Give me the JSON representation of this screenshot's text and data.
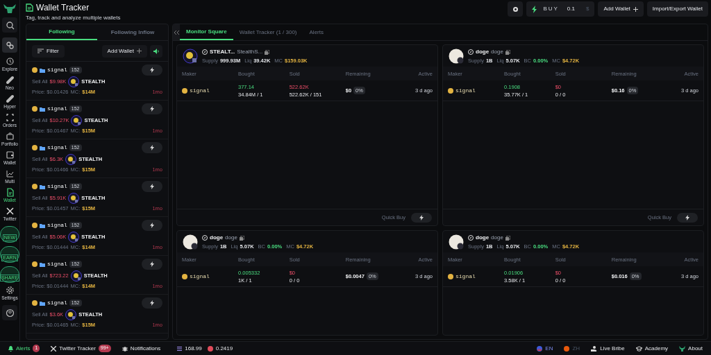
{
  "header": {
    "title": "Wallet Tracker",
    "subtitle": "Tag, track and analyze multiple wallets"
  },
  "toolbar": {
    "buy_label": "BUY",
    "buy_amount": "0.1",
    "currency": "$",
    "add_wallet": "Add Wallet",
    "import_export": "Import/Export Wallet"
  },
  "sidebar": {
    "items": [
      {
        "kind": "icon",
        "selected": false
      },
      {
        "kind": "icon",
        "selected": true
      },
      {
        "kind": "nav",
        "label": "Explore",
        "selected": false
      },
      {
        "kind": "nav",
        "label": "Neo",
        "selected": false
      },
      {
        "kind": "nav",
        "label": "Hyper",
        "selected": false
      },
      {
        "kind": "nav",
        "label": "Orders",
        "selected": false
      },
      {
        "kind": "nav",
        "label": "Portfolio",
        "selected": false
      },
      {
        "kind": "nav",
        "label": "Wallet",
        "selected": false
      },
      {
        "kind": "nav",
        "label": "Multi",
        "selected": false
      },
      {
        "kind": "nav",
        "label": "Wallet",
        "selected": true
      },
      {
        "kind": "nav",
        "label": "Twitter",
        "selected": false
      },
      {
        "kind": "badge",
        "label": "NEW"
      },
      {
        "kind": "badge",
        "label": "EARN"
      },
      {
        "kind": "badge",
        "label": "SHARE"
      },
      {
        "kind": "nav",
        "label": "Settings",
        "selected": false
      },
      {
        "kind": "icon",
        "selected": false
      }
    ]
  },
  "feed_tabs": [
    {
      "label": "Following",
      "selected": true
    },
    {
      "label": "Following Inflow",
      "selected": false
    }
  ],
  "feed_toolbar": {
    "filter": "Filter",
    "add_wallet": "Add Wallet"
  },
  "feed": [
    {
      "name": "signal",
      "count": "152",
      "action": "Sell All",
      "amount": "$9.98K",
      "token": "STEALTH",
      "price": "Price: $0.01426",
      "mc_label": "MC:",
      "mc": "$14M",
      "age": "1mo"
    },
    {
      "name": "signal",
      "count": "152",
      "action": "Sell All",
      "amount": "$10.27K",
      "token": "STEALTH",
      "price": "Price: $0.01467",
      "mc_label": "MC:",
      "mc": "$15M",
      "age": "1mo"
    },
    {
      "name": "signal",
      "count": "152",
      "action": "Sell All",
      "amount": "$6.3K",
      "token": "STEALTH",
      "price": "Price: $0.01466",
      "mc_label": "MC:",
      "mc": "$15M",
      "age": "1mo"
    },
    {
      "name": "signal",
      "count": "152",
      "action": "Sell All",
      "amount": "$5.91K",
      "token": "STEALTH",
      "price": "Price: $0.01457",
      "mc_label": "MC:",
      "mc": "$15M",
      "age": "1mo"
    },
    {
      "name": "signal",
      "count": "152",
      "action": "Sell All",
      "amount": "$5.06K",
      "token": "STEALTH",
      "price": "Price: $0.01444",
      "mc_label": "MC:",
      "mc": "$14M",
      "age": "1mo"
    },
    {
      "name": "signal",
      "count": "152",
      "action": "Sell All",
      "amount": "$723.22",
      "token": "STEALTH",
      "price": "Price: $0.01444",
      "mc_label": "MC:",
      "mc": "$14M",
      "age": "1mo"
    },
    {
      "name": "signal",
      "count": "152",
      "action": "Sell All",
      "amount": "$3.6K",
      "token": "STEALTH",
      "price": "Price: $0.01465",
      "mc_label": "MC:",
      "mc": "$15M",
      "age": "1mo"
    }
  ],
  "main_tabs": [
    {
      "label": "Monitor Square",
      "selected": true
    },
    {
      "label": "Wallet Tracker (1 / 300)",
      "selected": false
    },
    {
      "label": "Alerts",
      "selected": false
    }
  ],
  "cards": [
    {
      "symbol": "STEALT...",
      "name": "StealthS...",
      "stats": [
        {
          "label": "Supply",
          "value": "999.93M"
        },
        {
          "label": "Liq",
          "value": "39.42K"
        },
        {
          "label": "MC",
          "value": "$159.03K",
          "color": "#e3b341"
        }
      ],
      "columns": [
        "Maker",
        "Bought",
        "Sold",
        "Remaining",
        "Active"
      ],
      "rows": [
        {
          "maker": "signal",
          "bought": "377.14",
          "bought_sub": "34.84M / 1",
          "sold": "522.62K",
          "sold_sub": "522.62K / 151",
          "remaining": "$0",
          "pct": "0%",
          "active": "3 d ago"
        }
      ],
      "quick_buy": "Quick Buy"
    },
    {
      "symbol": "doge",
      "name": "doge",
      "stats": [
        {
          "label": "Supply",
          "value": "1B"
        },
        {
          "label": "Liq",
          "value": "5.07K"
        },
        {
          "label": "BC",
          "value": "0.00%",
          "color": "#4ade80"
        },
        {
          "label": "MC",
          "value": "$4.72K",
          "color": "#e3b341"
        }
      ],
      "columns": [
        "Maker",
        "Bought",
        "Sold",
        "Remaining",
        "Active"
      ],
      "rows": [
        {
          "maker": "signal",
          "bought": "0.1908",
          "bought_sub": "35.77K / 1",
          "sold": "$0",
          "sold_sub": "0 / 0",
          "remaining": "$0.16",
          "pct": "0%",
          "active": "3 d ago"
        }
      ],
      "quick_buy": "Quick Buy"
    },
    {
      "symbol": "doge",
      "name": "doge",
      "stats": [
        {
          "label": "Supply",
          "value": "1B"
        },
        {
          "label": "Liq",
          "value": "5.07K"
        },
        {
          "label": "BC",
          "value": "0.00%",
          "color": "#4ade80"
        },
        {
          "label": "MC",
          "value": "$4.72K",
          "color": "#e3b341"
        }
      ],
      "columns": [
        "Maker",
        "Bought",
        "Sold",
        "Remaining",
        "Active"
      ],
      "rows": [
        {
          "maker": "signal",
          "bought": "0.005332",
          "bought_sub": "1K / 1",
          "sold": "$0",
          "sold_sub": "0 / 0",
          "remaining": "$0.0047",
          "pct": "0%",
          "active": "3 d ago"
        }
      ]
    },
    {
      "symbol": "doge",
      "name": "doge",
      "stats": [
        {
          "label": "Supply",
          "value": "1B"
        },
        {
          "label": "Liq",
          "value": "5.07K"
        },
        {
          "label": "BC",
          "value": "0.00%",
          "color": "#4ade80"
        },
        {
          "label": "MC",
          "value": "$4.72K",
          "color": "#e3b341"
        }
      ],
      "columns": [
        "Maker",
        "Bought",
        "Sold",
        "Remaining",
        "Active"
      ],
      "rows": [
        {
          "maker": "signal",
          "bought": "0.01906",
          "bought_sub": "3.58K / 1",
          "sold": "$0",
          "sold_sub": "0 / 0",
          "remaining": "$0.016",
          "pct": "0%",
          "active": "3 d ago"
        }
      ]
    }
  ],
  "status_bar": {
    "alerts": "Alerts",
    "alerts_count": "1",
    "twitter": "Twitter Tracker",
    "twitter_count": "99+",
    "notifications": "Notifications",
    "sol_price": "168.99",
    "other_price": "0.2419",
    "languages": [
      {
        "label": "EN",
        "selected": true
      },
      {
        "label": "ZH",
        "selected": false
      }
    ],
    "links": [
      {
        "label": "Live Bribe"
      },
      {
        "label": "Academy"
      },
      {
        "label": "About"
      }
    ]
  }
}
